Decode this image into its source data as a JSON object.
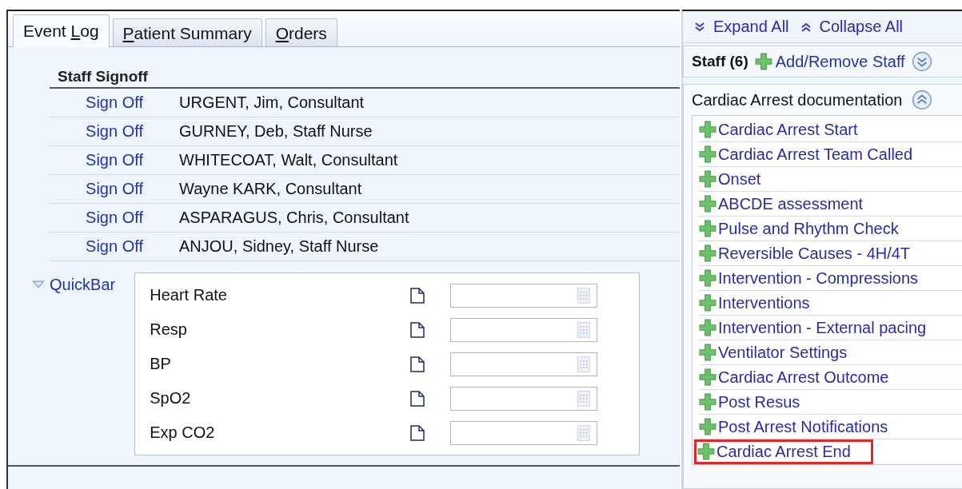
{
  "tabs": [
    {
      "before": "Event ",
      "access_key": "L",
      "after": "og",
      "selected": true
    },
    {
      "access_key": "P",
      "after": "atient Summary",
      "selected": false
    },
    {
      "access_key": "O",
      "after": "rders",
      "selected": false
    }
  ],
  "staff_signoff": {
    "title": "Staff Signoff",
    "rows": [
      {
        "action": "Sign Off",
        "name": "URGENT, Jim, Consultant"
      },
      {
        "action": "Sign Off",
        "name": "GURNEY, Deb, Staff Nurse"
      },
      {
        "action": "Sign Off",
        "name": "WHITECOAT, Walt, Consultant"
      },
      {
        "action": "Sign Off",
        "name": "Wayne KARK, Consultant"
      },
      {
        "action": "Sign Off",
        "name": "ASPARAGUS, Chris, Consultant"
      },
      {
        "action": "Sign Off",
        "name": "ANJOU, Sidney, Staff Nurse"
      }
    ]
  },
  "quickbar": {
    "label": "QuickBar",
    "expanded": true,
    "fields": [
      {
        "label": "Heart Rate"
      },
      {
        "label": "Resp"
      },
      {
        "label": "BP"
      },
      {
        "label": "SpO2"
      },
      {
        "label": "Exp CO2"
      }
    ]
  },
  "sidebar": {
    "expand_all": "Expand All",
    "collapse_all": "Collapse All",
    "staff": {
      "title": "Staff (6)",
      "action": "Add/Remove Staff"
    },
    "section": {
      "title": "Cardiac Arrest documentation",
      "expanded": true,
      "items": [
        {
          "label": "Cardiac Arrest Start",
          "highlighted": false
        },
        {
          "label": "Cardiac Arrest Team Called",
          "highlighted": false
        },
        {
          "label": "Onset",
          "highlighted": false
        },
        {
          "label": "ABCDE assessment",
          "highlighted": false
        },
        {
          "label": "Pulse and Rhythm Check",
          "highlighted": false
        },
        {
          "label": "Reversible Causes - 4H/4T",
          "highlighted": false
        },
        {
          "label": "Intervention - Compressions",
          "highlighted": false
        },
        {
          "label": "Interventions",
          "highlighted": false
        },
        {
          "label": "Intervention - External pacing",
          "highlighted": false
        },
        {
          "label": "Ventilator Settings",
          "highlighted": false
        },
        {
          "label": "Cardiac Arrest Outcome",
          "highlighted": false
        },
        {
          "label": "Post Resus",
          "highlighted": false
        },
        {
          "label": "Post Arrest Notifications",
          "highlighted": false
        },
        {
          "label": "Cardiac Arrest End",
          "highlighted": true
        }
      ]
    }
  }
}
